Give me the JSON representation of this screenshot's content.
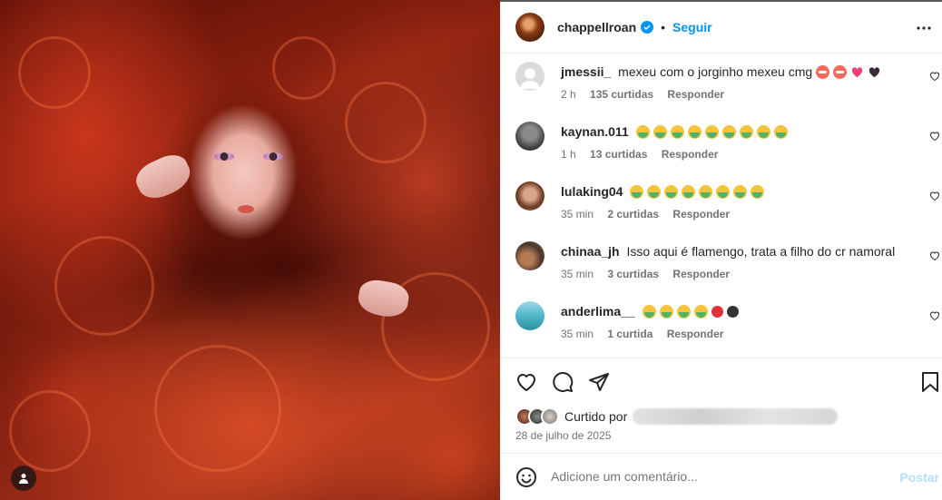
{
  "post": {
    "username": "chappellroan",
    "separator": "•",
    "follow_label": "Seguir",
    "date": "28 de julho de 2025",
    "liked_by_label": "Curtido por"
  },
  "comments": [
    {
      "username": "jmessii_",
      "text": "mexeu com o jorginho mexeu cmg",
      "emojis": [
        "rage",
        "rage",
        "pink-heart",
        "black-heart"
      ],
      "time": "2 h",
      "likes": "135 curtidas",
      "reply": "Responder"
    },
    {
      "username": "kaynan.011",
      "text": "",
      "emojis": [
        "sick",
        "sick",
        "sick",
        "sick",
        "sick",
        "sick",
        "sick",
        "sick",
        "sick"
      ],
      "time": "1 h",
      "likes": "13 curtidas",
      "reply": "Responder"
    },
    {
      "username": "lulaking04",
      "text": "",
      "emojis": [
        "sick",
        "sick",
        "sick",
        "sick",
        "sick",
        "sick",
        "sick",
        "sick"
      ],
      "time": "35 min",
      "likes": "2 curtidas",
      "reply": "Responder"
    },
    {
      "username": "chinaa_jh",
      "text": "Isso aqui é flamengo, trata a filho do cr namoral",
      "emojis": [],
      "time": "35 min",
      "likes": "3 curtidas",
      "reply": "Responder"
    },
    {
      "username": "anderlima__",
      "text": "",
      "emojis": [
        "sick",
        "sick",
        "sick",
        "sick",
        "red-circle",
        "black-circle"
      ],
      "time": "35 min",
      "likes": "1 curtida",
      "reply": "Responder"
    }
  ],
  "add_comment": {
    "placeholder": "Adicione um comentário...",
    "post_label": "Postar"
  },
  "colors": {
    "accent": "#0095f6",
    "muted": "#737373",
    "post_disabled": "#b2dffc"
  }
}
